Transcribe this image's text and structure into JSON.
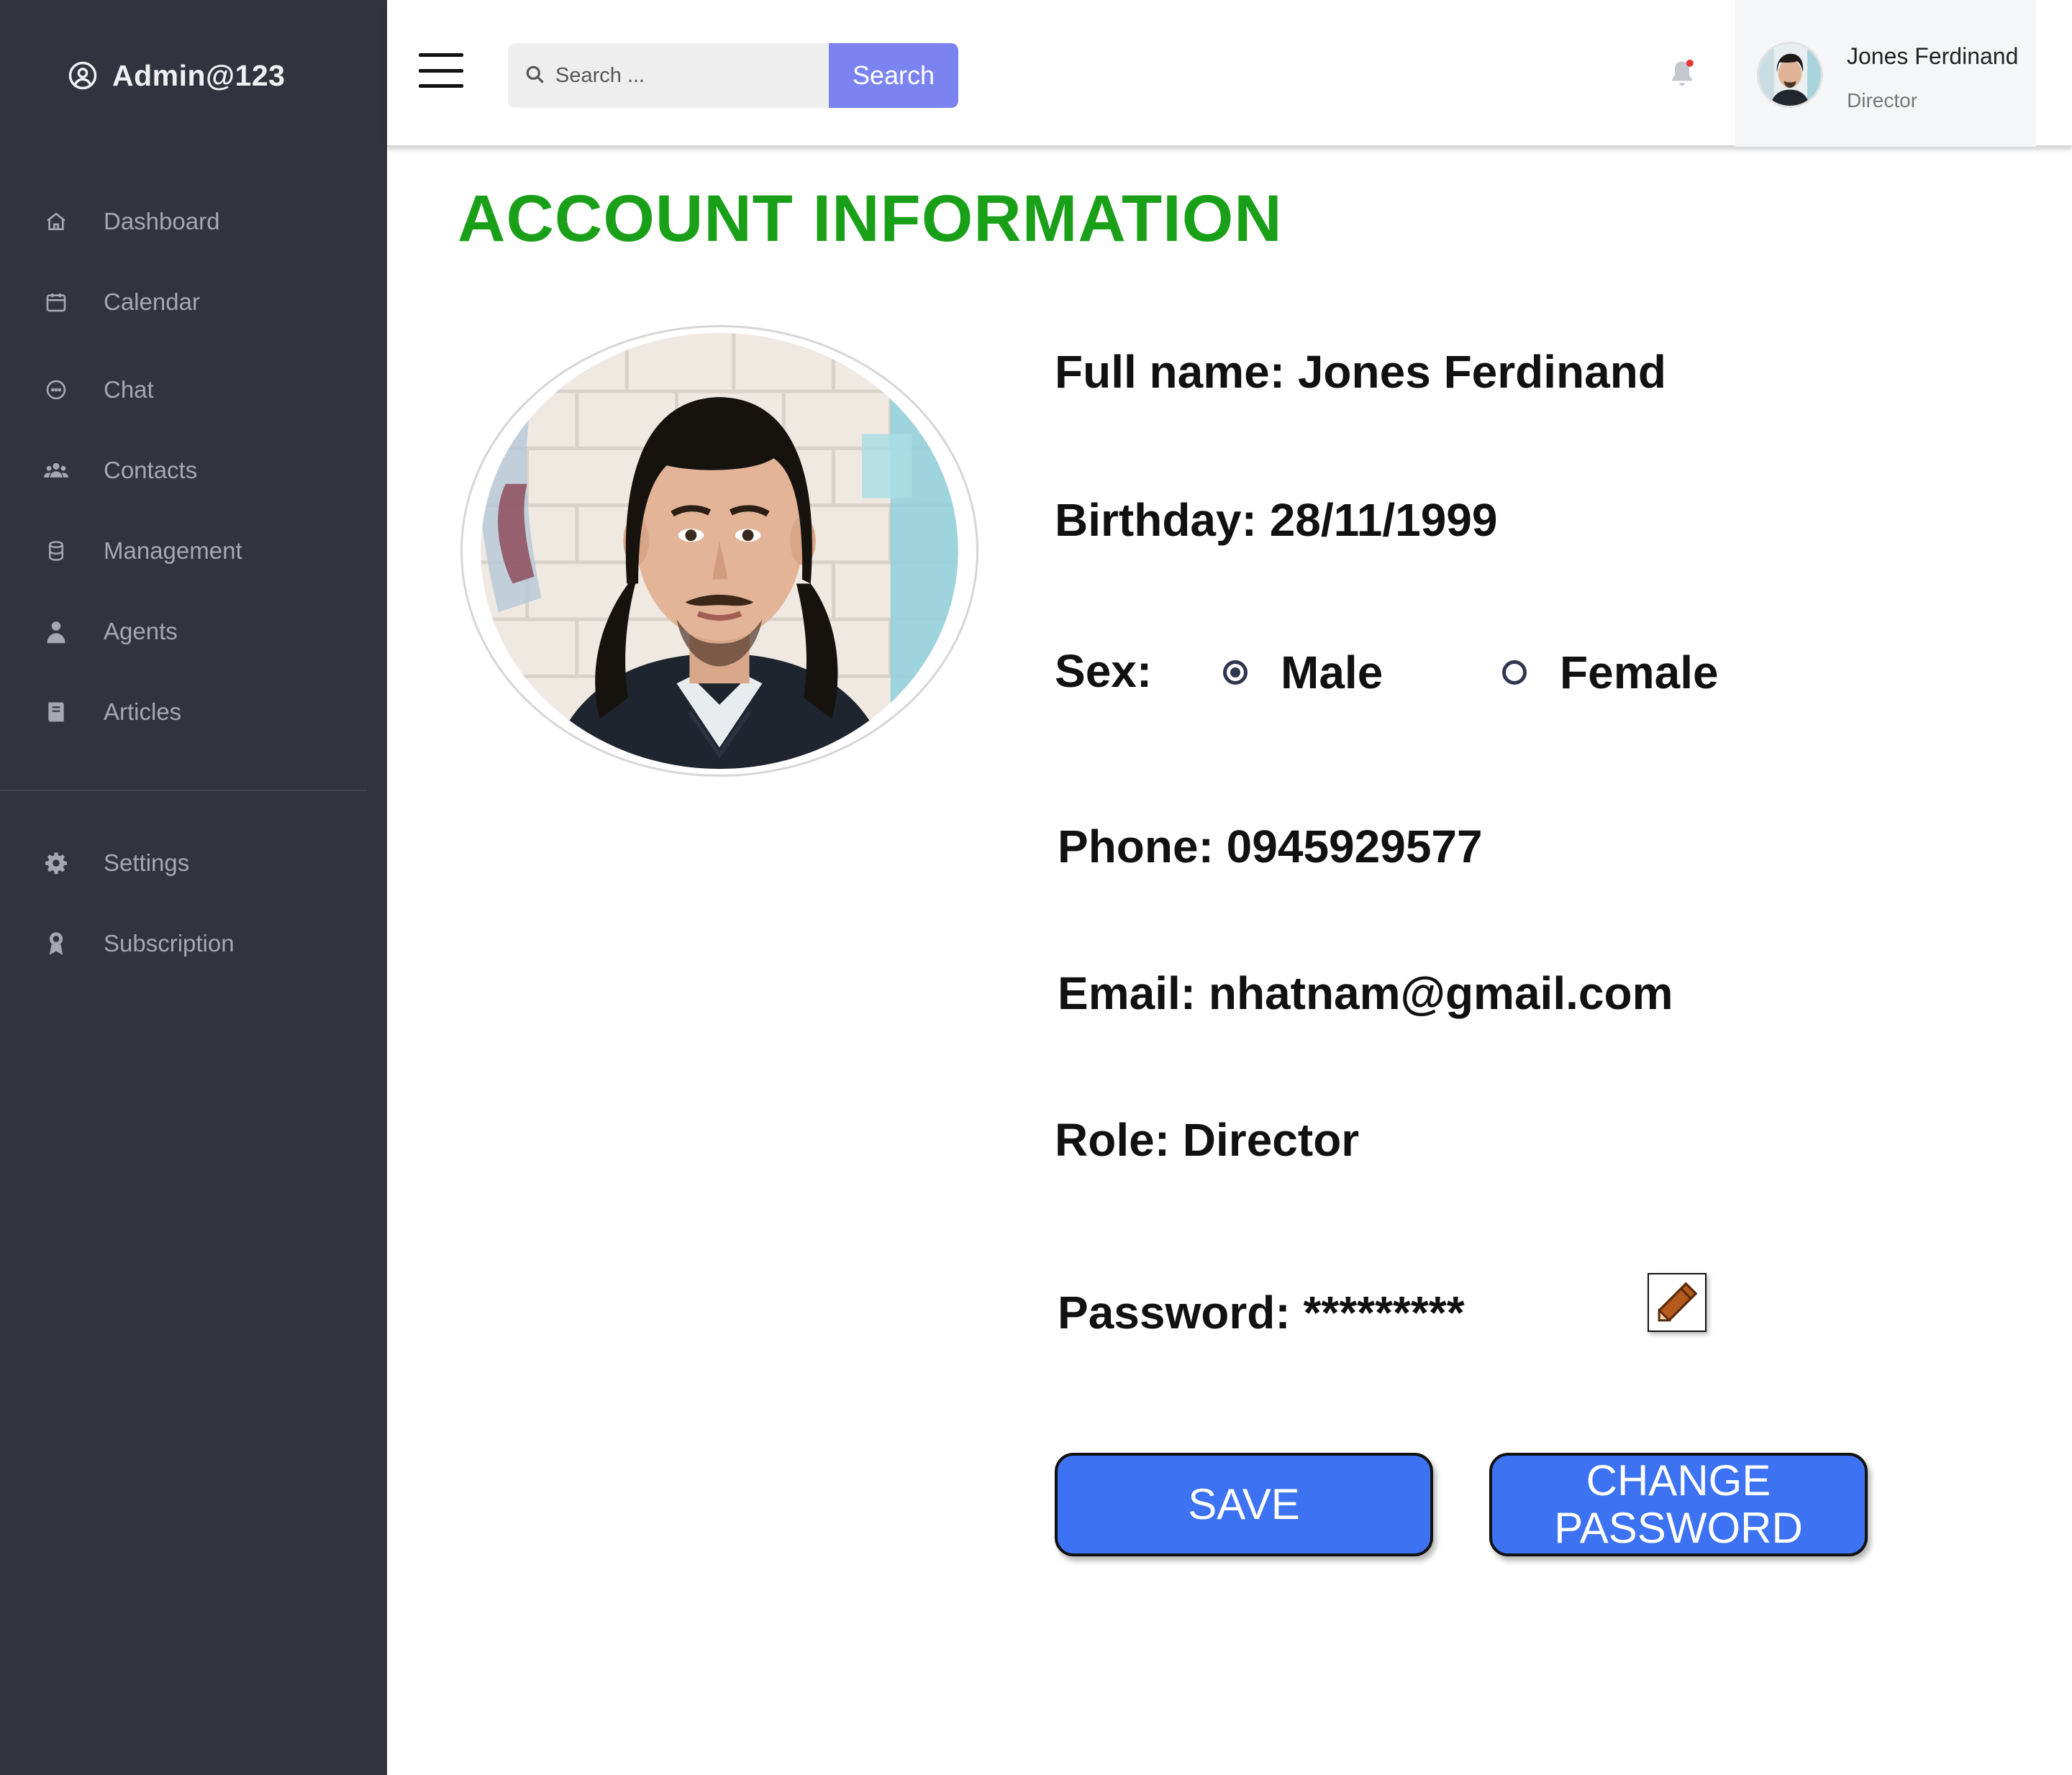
{
  "brand": {
    "username": "Admin@123"
  },
  "sidebar": {
    "items": [
      {
        "label": "Dashboard",
        "icon": "home-icon"
      },
      {
        "label": "Calendar",
        "icon": "calendar-icon"
      },
      {
        "label": "Chat",
        "icon": "chat-icon"
      },
      {
        "label": "Contacts",
        "icon": "contacts-icon"
      },
      {
        "label": "Management",
        "icon": "database-icon"
      },
      {
        "label": "Agents",
        "icon": "agent-icon"
      },
      {
        "label": "Articles",
        "icon": "book-icon"
      }
    ],
    "bottom_items": [
      {
        "label": "Settings",
        "icon": "gear-icon"
      },
      {
        "label": "Subscription",
        "icon": "award-icon"
      }
    ]
  },
  "header": {
    "search": {
      "placeholder": "Search ...",
      "button_label": "Search"
    },
    "notification": {
      "has_unread": true
    },
    "user": {
      "name": "Jones Ferdinand",
      "role": "Director"
    }
  },
  "main": {
    "title": "ACCOUNT INFORMATION",
    "fields": {
      "full_name": "Full name: Jones Ferdinand",
      "birthday": "Birthday: 28/11/1999",
      "sex_label": "Sex:",
      "phone": "Phone: 0945929577",
      "email": "Email: nhatnam@gmail.com",
      "role": "Role: Director",
      "password": "Password: *********"
    },
    "sex_options": [
      {
        "label": "Male",
        "selected": true
      },
      {
        "label": "Female",
        "selected": false
      }
    ],
    "buttons": {
      "save": "SAVE",
      "change_password": "CHANGE PASSWORD"
    }
  },
  "colors": {
    "sidebar_bg": "#33333f",
    "title_green": "#1aa018",
    "search_button": "#7b83f0",
    "action_button": "#3d73f2",
    "notification_dot": "#e53935"
  }
}
